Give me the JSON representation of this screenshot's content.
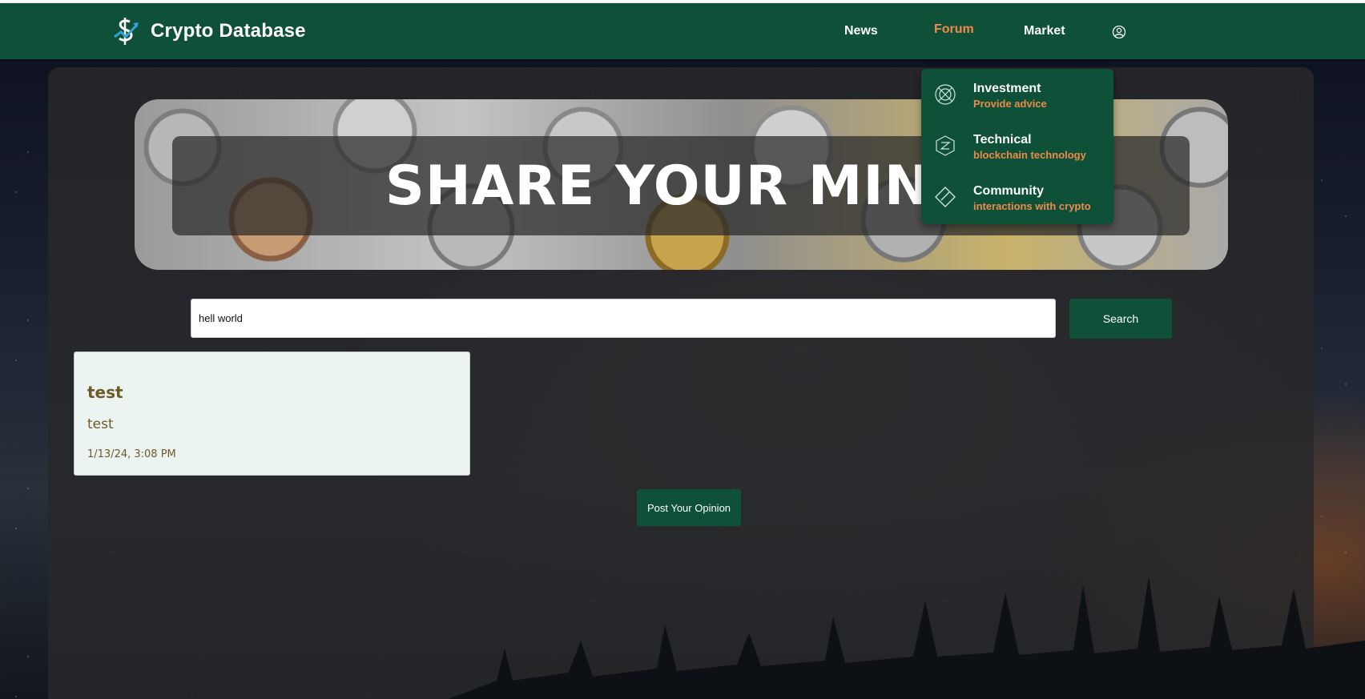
{
  "app": {
    "title": "Crypto Database"
  },
  "nav": {
    "news": "News",
    "forum": "Forum",
    "market": "Market",
    "user_icon": "user-circle-icon"
  },
  "forum_dropdown": {
    "items": [
      {
        "title": "Investment",
        "subtitle": "Provide advice",
        "icon": "investment-icon"
      },
      {
        "title": "Technical",
        "subtitle": "blockchain technology",
        "icon": "technical-icon"
      },
      {
        "title": "Community",
        "subtitle": "interactions with crypto",
        "icon": "community-icon"
      }
    ]
  },
  "banner": {
    "title": "SHARE YOUR MIND"
  },
  "search": {
    "value": "hell world",
    "button_label": "Search"
  },
  "posts": [
    {
      "title": "test",
      "body": "test",
      "date": "1/13/24, 3:08 PM"
    }
  ],
  "actions": {
    "post_opinion_label": "Post Your Opinion"
  },
  "colors": {
    "header_green": "#0e5138",
    "accent_orange": "#f08a4b",
    "card_bg": "#ecf4f1",
    "card_text": "#6d5a2a"
  }
}
